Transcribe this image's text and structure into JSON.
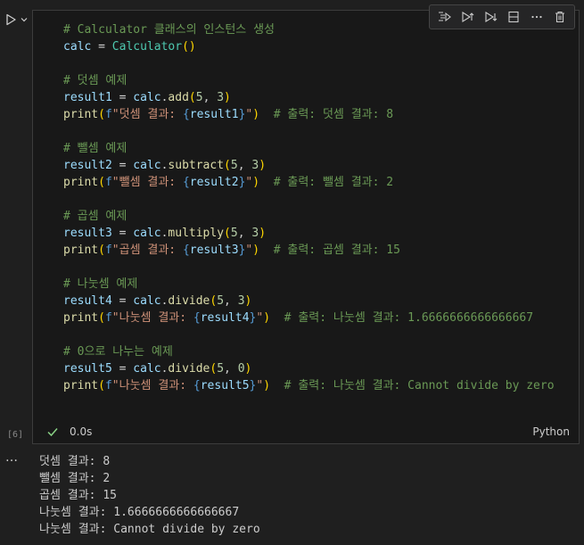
{
  "cell": {
    "execution_count": "[6]",
    "status_duration": "0.0s",
    "language": "Python",
    "code": [
      [
        [
          "c",
          "# Calculator 클래스의 인스턴스 생성"
        ]
      ],
      [
        [
          "v",
          "calc"
        ],
        [
          "o",
          " = "
        ],
        [
          "cls",
          "Calculator"
        ],
        [
          "p1",
          "()"
        ]
      ],
      [],
      [
        [
          "c",
          "# 덧셈 예제"
        ]
      ],
      [
        [
          "v",
          "result1"
        ],
        [
          "o",
          " = "
        ],
        [
          "v",
          "calc"
        ],
        [
          "d",
          "."
        ],
        [
          "fn",
          "add"
        ],
        [
          "p1",
          "("
        ],
        [
          "n",
          "5"
        ],
        [
          "d",
          ", "
        ],
        [
          "n",
          "3"
        ],
        [
          "p1",
          ")"
        ]
      ],
      [
        [
          "fn",
          "print"
        ],
        [
          "p1",
          "("
        ],
        [
          "f",
          "f"
        ],
        [
          "s",
          "\"덧셈 결과: "
        ],
        [
          "f",
          "{"
        ],
        [
          "v",
          "result1"
        ],
        [
          "f",
          "}"
        ],
        [
          "s",
          "\""
        ],
        [
          "p1",
          ")"
        ],
        [
          "d",
          "  "
        ],
        [
          "c",
          "# 출력: 덧셈 결과: 8"
        ]
      ],
      [],
      [
        [
          "c",
          "# 뺄셈 예제"
        ]
      ],
      [
        [
          "v",
          "result2"
        ],
        [
          "o",
          " = "
        ],
        [
          "v",
          "calc"
        ],
        [
          "d",
          "."
        ],
        [
          "fn",
          "subtract"
        ],
        [
          "p1",
          "("
        ],
        [
          "n",
          "5"
        ],
        [
          "d",
          ", "
        ],
        [
          "n",
          "3"
        ],
        [
          "p1",
          ")"
        ]
      ],
      [
        [
          "fn",
          "print"
        ],
        [
          "p1",
          "("
        ],
        [
          "f",
          "f"
        ],
        [
          "s",
          "\"뺄셈 결과: "
        ],
        [
          "f",
          "{"
        ],
        [
          "v",
          "result2"
        ],
        [
          "f",
          "}"
        ],
        [
          "s",
          "\""
        ],
        [
          "p1",
          ")"
        ],
        [
          "d",
          "  "
        ],
        [
          "c",
          "# 출력: 뺄셈 결과: 2"
        ]
      ],
      [],
      [
        [
          "c",
          "# 곱셈 예제"
        ]
      ],
      [
        [
          "v",
          "result3"
        ],
        [
          "o",
          " = "
        ],
        [
          "v",
          "calc"
        ],
        [
          "d",
          "."
        ],
        [
          "fn",
          "multiply"
        ],
        [
          "p1",
          "("
        ],
        [
          "n",
          "5"
        ],
        [
          "d",
          ", "
        ],
        [
          "n",
          "3"
        ],
        [
          "p1",
          ")"
        ]
      ],
      [
        [
          "fn",
          "print"
        ],
        [
          "p1",
          "("
        ],
        [
          "f",
          "f"
        ],
        [
          "s",
          "\"곱셈 결과: "
        ],
        [
          "f",
          "{"
        ],
        [
          "v",
          "result3"
        ],
        [
          "f",
          "}"
        ],
        [
          "s",
          "\""
        ],
        [
          "p1",
          ")"
        ],
        [
          "d",
          "  "
        ],
        [
          "c",
          "# 출력: 곱셈 결과: 15"
        ]
      ],
      [],
      [
        [
          "c",
          "# 나눗셈 예제"
        ]
      ],
      [
        [
          "v",
          "result4"
        ],
        [
          "o",
          " = "
        ],
        [
          "v",
          "calc"
        ],
        [
          "d",
          "."
        ],
        [
          "fn",
          "divide"
        ],
        [
          "p1",
          "("
        ],
        [
          "n",
          "5"
        ],
        [
          "d",
          ", "
        ],
        [
          "n",
          "3"
        ],
        [
          "p1",
          ")"
        ]
      ],
      [
        [
          "fn",
          "print"
        ],
        [
          "p1",
          "("
        ],
        [
          "f",
          "f"
        ],
        [
          "s",
          "\"나눗셈 결과: "
        ],
        [
          "f",
          "{"
        ],
        [
          "v",
          "result4"
        ],
        [
          "f",
          "}"
        ],
        [
          "s",
          "\""
        ],
        [
          "p1",
          ")"
        ],
        [
          "d",
          "  "
        ],
        [
          "c",
          "# 출력: 나눗셈 결과: 1.6666666666666667"
        ]
      ],
      [],
      [
        [
          "c",
          "# 0으로 나누는 예제"
        ]
      ],
      [
        [
          "v",
          "result5"
        ],
        [
          "o",
          " = "
        ],
        [
          "v",
          "calc"
        ],
        [
          "d",
          "."
        ],
        [
          "fn",
          "divide"
        ],
        [
          "p1",
          "("
        ],
        [
          "n",
          "5"
        ],
        [
          "d",
          ", "
        ],
        [
          "n",
          "0"
        ],
        [
          "p1",
          ")"
        ]
      ],
      [
        [
          "fn",
          "print"
        ],
        [
          "p1",
          "("
        ],
        [
          "f",
          "f"
        ],
        [
          "s",
          "\"나눗셈 결과: "
        ],
        [
          "f",
          "{"
        ],
        [
          "v",
          "result5"
        ],
        [
          "f",
          "}"
        ],
        [
          "s",
          "\""
        ],
        [
          "p1",
          ")"
        ],
        [
          "d",
          "  "
        ],
        [
          "c",
          "# 출력: 나눗셈 결과: Cannot divide by zero"
        ]
      ]
    ]
  },
  "toolbar": {
    "icons": [
      "run-by-line-icon",
      "execute-above-icon",
      "execute-below-icon",
      "split-cell-icon",
      "more-actions-icon",
      "delete-cell-icon"
    ]
  },
  "output": {
    "menu_glyph": "…",
    "lines": [
      "덧셈 결과: 8",
      "뺄셈 결과: 2",
      "곱셈 결과: 15",
      "나눗셈 결과: 1.6666666666666667",
      "나눗셈 결과: Cannot divide by zero"
    ]
  },
  "colors": {
    "background": "#1f1f1f",
    "cell_background": "#181818",
    "comment": "#6a9955",
    "variable": "#9cdcfe",
    "class": "#4ec9b0",
    "function": "#dcdcaa",
    "bracket": "#ffd700",
    "number": "#b5cea8",
    "string": "#ce9178",
    "keyword": "#569cd6",
    "success": "#89d185"
  }
}
